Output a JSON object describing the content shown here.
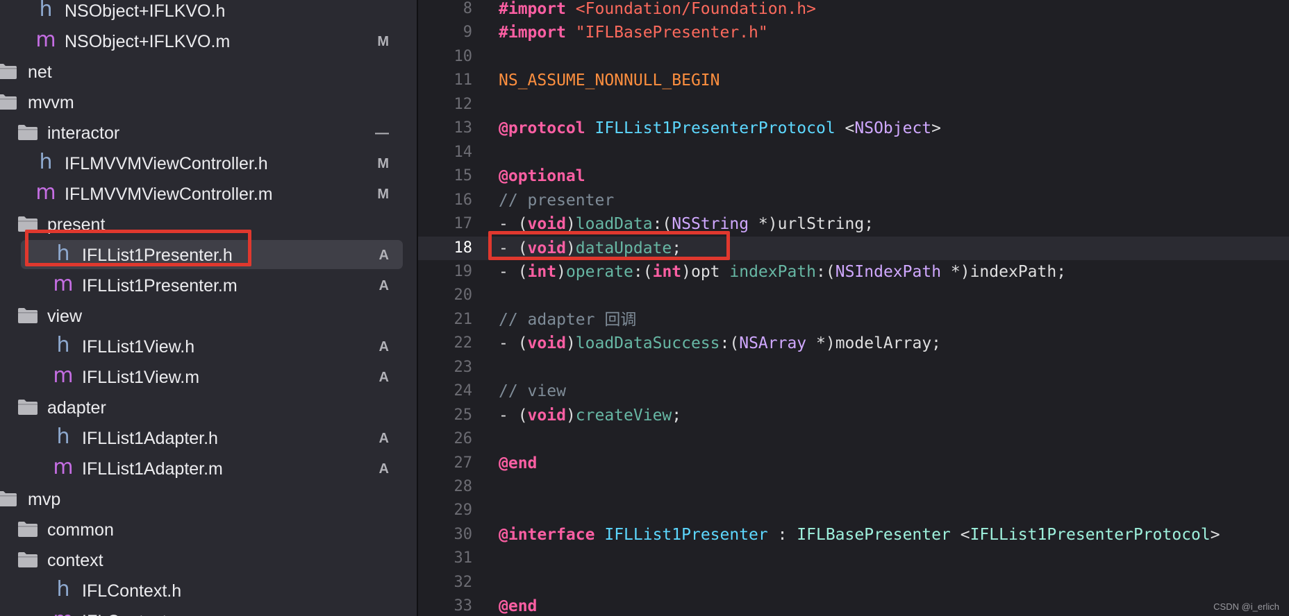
{
  "colors": {
    "background": "#1f1f24",
    "navigator": "#2a2a31",
    "highlight_box": "#e0382e",
    "keyword": "#fc5fa3",
    "comment": "#7f8c98",
    "type": "#d0a8ff",
    "declaration": "#5dd8ff",
    "method": "#67b7a4"
  },
  "navigator": {
    "rows": [
      {
        "kind": "file",
        "type": "h",
        "icon": "header-file-icon",
        "label": "NSObject+IFLKVO.h",
        "badge": "",
        "indent": 1
      },
      {
        "kind": "file",
        "type": "m",
        "icon": "implementation-file-icon",
        "label": "NSObject+IFLKVO.m",
        "badge": "M",
        "indent": 1
      },
      {
        "kind": "folder",
        "label": "net",
        "badge": "",
        "indent": 0,
        "disclosure": ""
      },
      {
        "kind": "folder",
        "label": "mvvm",
        "badge": "",
        "indent": 0,
        "disclosure": ""
      },
      {
        "kind": "folder",
        "label": "interactor",
        "badge": "—",
        "indent": 1,
        "disclosure": "›"
      },
      {
        "kind": "file",
        "type": "h",
        "icon": "header-file-icon",
        "label": "IFLMVVMViewController.h",
        "badge": "M",
        "indent": 1
      },
      {
        "kind": "file",
        "type": "m",
        "icon": "implementation-file-icon",
        "label": "IFLMVVMViewController.m",
        "badge": "M",
        "indent": 1
      },
      {
        "kind": "folder",
        "label": "present",
        "badge": "",
        "indent": 1,
        "disclosure": "⌄"
      },
      {
        "kind": "file",
        "type": "h",
        "icon": "header-file-icon",
        "label": "IFLList1Presenter.h",
        "badge": "A",
        "indent": 2,
        "selected": true
      },
      {
        "kind": "file",
        "type": "m",
        "icon": "implementation-file-icon",
        "label": "IFLList1Presenter.m",
        "badge": "A",
        "indent": 2
      },
      {
        "kind": "folder",
        "label": "view",
        "badge": "",
        "indent": 1,
        "disclosure": "⌄"
      },
      {
        "kind": "file",
        "type": "h",
        "icon": "header-file-icon",
        "label": "IFLList1View.h",
        "badge": "A",
        "indent": 2
      },
      {
        "kind": "file",
        "type": "m",
        "icon": "implementation-file-icon",
        "label": "IFLList1View.m",
        "badge": "A",
        "indent": 2
      },
      {
        "kind": "folder",
        "label": "adapter",
        "badge": "",
        "indent": 1,
        "disclosure": "⌄"
      },
      {
        "kind": "file",
        "type": "h",
        "icon": "header-file-icon",
        "label": "IFLList1Adapter.h",
        "badge": "A",
        "indent": 2
      },
      {
        "kind": "file",
        "type": "m",
        "icon": "implementation-file-icon",
        "label": "IFLList1Adapter.m",
        "badge": "A",
        "indent": 2
      },
      {
        "kind": "folder",
        "label": "mvp",
        "badge": "",
        "indent": 0,
        "disclosure": ""
      },
      {
        "kind": "folder",
        "label": "common",
        "badge": "",
        "indent": 1,
        "disclosure": "›"
      },
      {
        "kind": "folder",
        "label": "context",
        "badge": "",
        "indent": 1,
        "disclosure": "⌄"
      },
      {
        "kind": "file",
        "type": "h",
        "icon": "header-file-icon",
        "label": "IFLContext.h",
        "badge": "",
        "indent": 2
      },
      {
        "kind": "file",
        "type": "m",
        "icon": "implementation-file-icon",
        "label": "IFLContext.m",
        "badge": "",
        "indent": 2
      }
    ]
  },
  "editor": {
    "current_line": "18",
    "lines": [
      {
        "n": "8",
        "tokens": [
          {
            "t": "#import ",
            "c": "kw"
          },
          {
            "t": "<Foundation/Foundation.h>",
            "c": "str"
          }
        ]
      },
      {
        "n": "9",
        "tokens": [
          {
            "t": "#import ",
            "c": "kw"
          },
          {
            "t": "\"IFLBasePresenter.h\"",
            "c": "str"
          }
        ]
      },
      {
        "n": "10",
        "tokens": []
      },
      {
        "n": "11",
        "tokens": [
          {
            "t": "NS_ASSUME_NONNULL_BEGIN",
            "c": "mac"
          }
        ]
      },
      {
        "n": "12",
        "tokens": []
      },
      {
        "n": "13",
        "tokens": [
          {
            "t": "@protocol",
            "c": "kw"
          },
          {
            "t": " ",
            "c": ""
          },
          {
            "t": "IFLList1PresenterProtocol",
            "c": "decl"
          },
          {
            "t": " <",
            "c": ""
          },
          {
            "t": "NSObject",
            "c": "type"
          },
          {
            "t": ">",
            "c": ""
          }
        ]
      },
      {
        "n": "14",
        "tokens": []
      },
      {
        "n": "15",
        "tokens": [
          {
            "t": "@optional",
            "c": "kw"
          }
        ]
      },
      {
        "n": "16",
        "tokens": [
          {
            "t": "// presenter",
            "c": "cm"
          }
        ]
      },
      {
        "n": "17",
        "tokens": [
          {
            "t": "- (",
            "c": ""
          },
          {
            "t": "void",
            "c": "kw"
          },
          {
            "t": ")",
            "c": ""
          },
          {
            "t": "loadData",
            "c": "meth"
          },
          {
            "t": ":(",
            "c": ""
          },
          {
            "t": "NSString",
            "c": "type"
          },
          {
            "t": " *)urlString;",
            "c": ""
          }
        ]
      },
      {
        "n": "18",
        "tokens": [
          {
            "t": "- (",
            "c": ""
          },
          {
            "t": "void",
            "c": "kw"
          },
          {
            "t": ")",
            "c": ""
          },
          {
            "t": "dataUpdate",
            "c": "meth"
          },
          {
            "t": ";",
            "c": ""
          }
        ]
      },
      {
        "n": "19",
        "tokens": [
          {
            "t": "- (",
            "c": ""
          },
          {
            "t": "int",
            "c": "kw"
          },
          {
            "t": ")",
            "c": ""
          },
          {
            "t": "operate",
            "c": "meth"
          },
          {
            "t": ":(",
            "c": ""
          },
          {
            "t": "int",
            "c": "kw"
          },
          {
            "t": ")opt ",
            "c": ""
          },
          {
            "t": "indexPath",
            "c": "meth"
          },
          {
            "t": ":(",
            "c": ""
          },
          {
            "t": "NSIndexPath",
            "c": "type"
          },
          {
            "t": " *)indexPath;",
            "c": ""
          }
        ]
      },
      {
        "n": "20",
        "tokens": []
      },
      {
        "n": "21",
        "tokens": [
          {
            "t": "// adapter 回调",
            "c": "cm"
          }
        ]
      },
      {
        "n": "22",
        "tokens": [
          {
            "t": "- (",
            "c": ""
          },
          {
            "t": "void",
            "c": "kw"
          },
          {
            "t": ")",
            "c": ""
          },
          {
            "t": "loadDataSuccess",
            "c": "meth"
          },
          {
            "t": ":(",
            "c": ""
          },
          {
            "t": "NSArray",
            "c": "type"
          },
          {
            "t": " *)modelArray;",
            "c": ""
          }
        ]
      },
      {
        "n": "23",
        "tokens": []
      },
      {
        "n": "24",
        "tokens": [
          {
            "t": "// view",
            "c": "cm"
          }
        ]
      },
      {
        "n": "25",
        "tokens": [
          {
            "t": "- (",
            "c": ""
          },
          {
            "t": "void",
            "c": "kw"
          },
          {
            "t": ")",
            "c": ""
          },
          {
            "t": "createView",
            "c": "meth"
          },
          {
            "t": ";",
            "c": ""
          }
        ]
      },
      {
        "n": "26",
        "tokens": []
      },
      {
        "n": "27",
        "tokens": [
          {
            "t": "@end",
            "c": "kw"
          }
        ]
      },
      {
        "n": "28",
        "tokens": []
      },
      {
        "n": "29",
        "tokens": []
      },
      {
        "n": "30",
        "tokens": [
          {
            "t": "@interface",
            "c": "kw"
          },
          {
            "t": " ",
            "c": ""
          },
          {
            "t": "IFLList1Presenter",
            "c": "decl"
          },
          {
            "t": " : ",
            "c": ""
          },
          {
            "t": "IFLBasePresenter",
            "c": "cls"
          },
          {
            "t": " <",
            "c": ""
          },
          {
            "t": "IFLList1PresenterProtocol",
            "c": "cls"
          },
          {
            "t": ">",
            "c": ""
          }
        ]
      },
      {
        "n": "31",
        "tokens": []
      },
      {
        "n": "32",
        "tokens": []
      },
      {
        "n": "33",
        "tokens": [
          {
            "t": "@end",
            "c": "kw"
          }
        ]
      }
    ]
  },
  "watermark": "CSDN @i_erlich"
}
